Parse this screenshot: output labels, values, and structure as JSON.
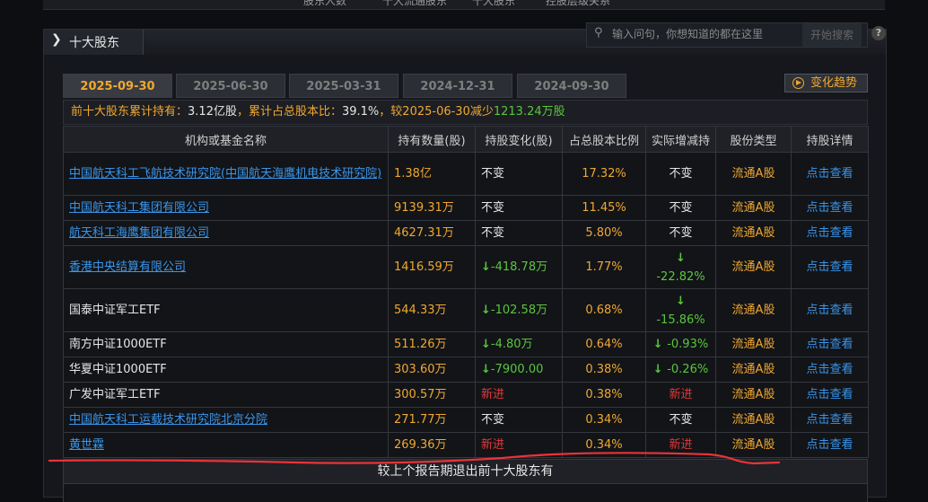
{
  "top_nav": [
    "股东人数",
    "十大流通股东",
    "十大股东",
    "控股层级关系"
  ],
  "panel": {
    "title": "十大股东"
  },
  "search": {
    "placeholder": "输入问句，你想知道的都在这里",
    "button": "开始搜索",
    "help": "?"
  },
  "tabs": [
    {
      "label": "2025-09-30",
      "active": true
    },
    {
      "label": "2025-06-30",
      "active": false
    },
    {
      "label": "2025-03-31",
      "active": false
    },
    {
      "label": "2024-12-31",
      "active": false
    },
    {
      "label": "2024-09-30",
      "active": false
    }
  ],
  "trend_button": {
    "label": "变化趋势"
  },
  "summary": {
    "prefix": "前十大股东累计持有：",
    "shares": "3.12亿股",
    "mid1": "，累计占总股本比：",
    "ratio": "39.1%",
    "mid2": "，较2025-06-30减少",
    "change": "1213.24万股"
  },
  "table": {
    "headers": [
      "机构或基金名称",
      "持有数量(股)",
      "持股变化(股)",
      "占总股本比例",
      "实际增减持",
      "股份类型",
      "持股详情"
    ],
    "rows": [
      {
        "name": "中国航天科工飞航技术研究院(中国航天海鹰机电技术研究院)",
        "link": true,
        "holding": "1.38亿",
        "change": "不变",
        "change_type": "same",
        "ratio": "17.32%",
        "actual": "不变",
        "actual_type": "same",
        "share_type": "流通A股",
        "detail": "点击查看"
      },
      {
        "name": "中国航天科工集团有限公司",
        "link": true,
        "holding": "9139.31万",
        "change": "不变",
        "change_type": "same",
        "ratio": "11.45%",
        "actual": "不变",
        "actual_type": "same",
        "share_type": "流通A股",
        "detail": "点击查看"
      },
      {
        "name": "航天科工海鹰集团有限公司",
        "link": true,
        "holding": "4627.31万",
        "change": "不变",
        "change_type": "same",
        "ratio": "5.80%",
        "actual": "不变",
        "actual_type": "same",
        "share_type": "流通A股",
        "detail": "点击查看"
      },
      {
        "name": "香港中央结算有限公司",
        "link": true,
        "holding": "1416.59万",
        "change": "-418.78万",
        "change_type": "down",
        "ratio": "1.77%",
        "actual": "-22.82%",
        "actual_type": "down",
        "share_type": "流通A股",
        "detail": "点击查看"
      },
      {
        "name": "国泰中证军工ETF",
        "link": false,
        "holding": "544.33万",
        "change": "-102.58万",
        "change_type": "down",
        "ratio": "0.68%",
        "actual": "-15.86%",
        "actual_type": "down",
        "share_type": "流通A股",
        "detail": "点击查看"
      },
      {
        "name": "南方中证1000ETF",
        "link": false,
        "holding": "511.26万",
        "change": "-4.80万",
        "change_type": "down",
        "ratio": "0.64%",
        "actual": "-0.93%",
        "actual_type": "down",
        "share_type": "流通A股",
        "detail": "点击查看"
      },
      {
        "name": "华夏中证1000ETF",
        "link": false,
        "holding": "303.60万",
        "change": "-7900.00",
        "change_type": "down",
        "ratio": "0.38%",
        "actual": "-0.26%",
        "actual_type": "down",
        "share_type": "流通A股",
        "detail": "点击查看"
      },
      {
        "name": "广发中证军工ETF",
        "link": false,
        "holding": "300.57万",
        "change": "新进",
        "change_type": "new",
        "ratio": "0.38%",
        "actual": "新进",
        "actual_type": "new",
        "share_type": "流通A股",
        "detail": "点击查看"
      },
      {
        "name": "中国航天科工运载技术研究院北京分院",
        "link": true,
        "holding": "271.77万",
        "change": "不变",
        "change_type": "same",
        "ratio": "0.34%",
        "actual": "不变",
        "actual_type": "same",
        "share_type": "流通A股",
        "detail": "点击查看"
      },
      {
        "name": "黄世霖",
        "link": true,
        "holding": "269.36万",
        "change": "新进",
        "change_type": "new",
        "ratio": "0.34%",
        "actual": "新进",
        "actual_type": "new",
        "share_type": "流通A股",
        "detail": "点击查看"
      }
    ]
  },
  "exit_label": "较上个报告期退出前十大股东有",
  "colors": {
    "orange": "#f0a830",
    "link": "#3a95ea",
    "green": "#5ac63c",
    "red": "#e03a3a",
    "annotation": "#e8333a"
  },
  "arrow_icon": "down-arrow-icon"
}
